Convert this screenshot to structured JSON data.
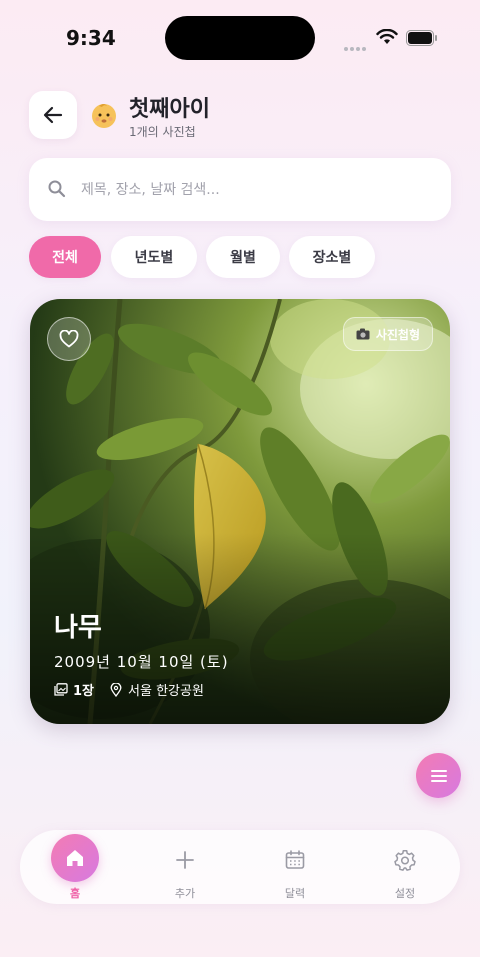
{
  "status_bar": {
    "time": "9:34"
  },
  "header": {
    "title": "첫째아이",
    "subtitle": "1개의 사진첩",
    "icons": {
      "back": "arrow-left-icon",
      "avatar": "baby-emoji-icon"
    }
  },
  "search": {
    "placeholder": "제목, 장소, 날짜 검색...",
    "value": "",
    "icon": "search-icon"
  },
  "filters": [
    {
      "label": "전체",
      "active": true
    },
    {
      "label": "년도별",
      "active": false
    },
    {
      "label": "월별",
      "active": false
    },
    {
      "label": "장소별",
      "active": false
    }
  ],
  "album_card": {
    "title": "나무",
    "date": "2009년 10월 10일 (토)",
    "photo_count": "1장",
    "location": "서울 한강공원",
    "type_badge": "사진첩형",
    "icons": {
      "favorite": "heart-outline-icon",
      "badge": "camera-icon",
      "count": "photos-icon",
      "location": "map-pin-icon"
    }
  },
  "fab": {
    "icon": "menu-icon"
  },
  "bottom_nav": [
    {
      "label": "홈",
      "icon": "home-icon",
      "active": true
    },
    {
      "label": "추가",
      "icon": "plus-icon",
      "active": false
    },
    {
      "label": "달력",
      "icon": "calendar-icon",
      "active": false
    },
    {
      "label": "설정",
      "icon": "gear-icon",
      "active": false
    }
  ],
  "colors": {
    "accent": "#f06aa9",
    "accent_gradient_end": "#d77ae0",
    "text": "#22222a",
    "muted": "#8f8f99"
  }
}
